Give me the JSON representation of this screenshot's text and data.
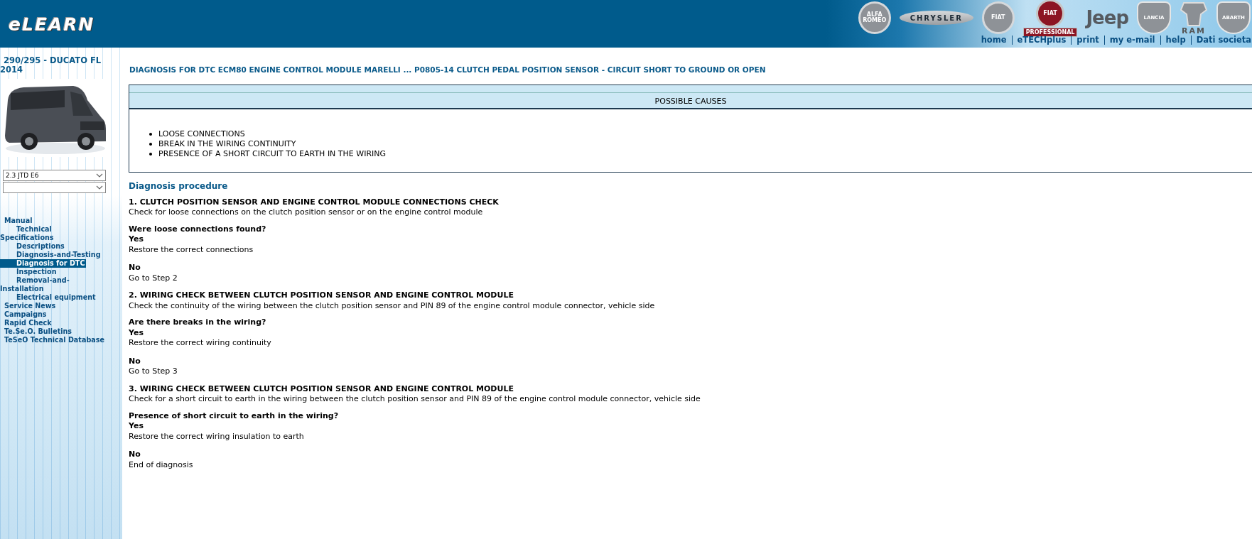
{
  "header": {
    "logo": "eLEARN",
    "brands": [
      {
        "kind": "round",
        "label": "ALFA ROMEO"
      },
      {
        "kind": "wing",
        "label": "CHRYSLER"
      },
      {
        "kind": "round",
        "label": "FIAT"
      },
      {
        "kind": "red",
        "label": "FIAT",
        "badge": "PROFESSIONAL"
      },
      {
        "kind": "word",
        "label": "Jeep"
      },
      {
        "kind": "shield",
        "label": "LANCIA"
      },
      {
        "kind": "ram",
        "label": "RAM"
      },
      {
        "kind": "shield",
        "label": "ABARTH"
      }
    ],
    "links": [
      "home",
      "eTECHplus",
      "print",
      "my e-mail",
      "help",
      "Dati societa"
    ]
  },
  "sidebar": {
    "vehicle": "290/295 - DUCATO FL 2014",
    "engine_select": {
      "value": "2.3 JTD E6"
    },
    "nav": [
      {
        "label": "Manual",
        "selected": false,
        "children": [
          {
            "label": "Technical Specifications",
            "selected": false
          },
          {
            "label": "Descriptions",
            "selected": false
          },
          {
            "label": "Diagnosis-and-Testing",
            "selected": false
          },
          {
            "label": "Diagnosis for DTC",
            "selected": true
          },
          {
            "label": "Inspection",
            "selected": false
          },
          {
            "label": "Removal-and-Installation",
            "selected": false
          },
          {
            "label": "Electrical equipment",
            "selected": false
          }
        ]
      },
      {
        "label": "Service News",
        "selected": false
      },
      {
        "label": "Campaigns",
        "selected": false
      },
      {
        "label": "Rapid Check",
        "selected": false
      },
      {
        "label": "Te.Se.O. Bulletins",
        "selected": false
      },
      {
        "label": "TeSeO Technical Database",
        "selected": false
      }
    ]
  },
  "page_title": "DIAGNOSIS FOR DTC ECM80 ENGINE CONTROL MODULE MARELLI ... P0805-14 CLUTCH PEDAL POSITION SENSOR - CIRCUIT SHORT TO GROUND OR OPEN",
  "causes": {
    "title": "POSSIBLE CAUSES",
    "items": [
      "LOOSE CONNECTIONS",
      "BREAK IN THE WIRING CONTINUITY",
      "PRESENCE OF A SHORT CIRCUIT TO EARTH IN THE WIRING"
    ]
  },
  "procedure": {
    "title": "Diagnosis procedure",
    "steps": [
      {
        "title": "1. CLUTCH POSITION SENSOR AND ENGINE CONTROL MODULE CONNECTIONS CHECK",
        "text": "Check for loose connections on the clutch position sensor or on the engine control module",
        "question": "Were loose connections found?",
        "answers": [
          {
            "answer": "Yes",
            "action": "Restore the correct connections"
          },
          {
            "answer": "No",
            "action": "Go to Step 2"
          }
        ]
      },
      {
        "title": "2. WIRING CHECK BETWEEN CLUTCH POSITION SENSOR AND ENGINE CONTROL MODULE",
        "text": "Check the continuity of the wiring between the clutch position sensor and PIN 89 of the engine control module connector, vehicle side",
        "question": "Are there breaks in the wiring?",
        "answers": [
          {
            "answer": "Yes",
            "action": "Restore the correct wiring continuity"
          },
          {
            "answer": "No",
            "action": "Go to Step 3"
          }
        ]
      },
      {
        "title": "3. WIRING CHECK BETWEEN CLUTCH POSITION SENSOR AND ENGINE CONTROL MODULE",
        "text": "Check for a short circuit to earth in the wiring between the clutch position sensor and PIN 89 of the engine control module connector, vehicle side",
        "question": "Presence of short circuit to earth in the wiring?",
        "answers": [
          {
            "answer": "Yes",
            "action": "Restore the correct wiring insulation to earth"
          },
          {
            "answer": "No",
            "action": "End of diagnosis"
          }
        ]
      }
    ]
  }
}
